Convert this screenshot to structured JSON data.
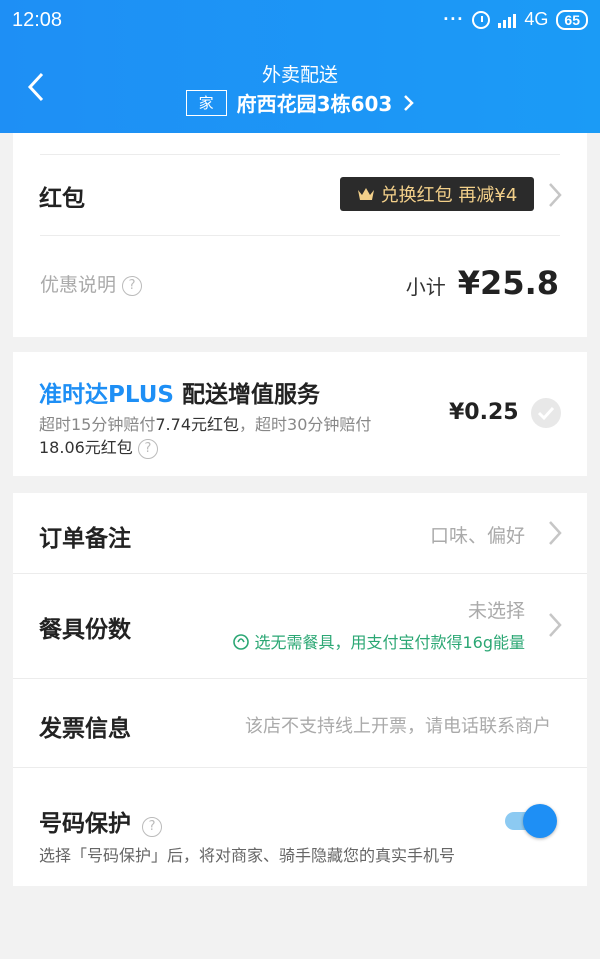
{
  "status_bar": {
    "time": "12:08",
    "network": "4G",
    "battery": "65"
  },
  "header": {
    "title": "外卖配送",
    "address_tag": "家",
    "address": "府西花园3栋603"
  },
  "coupon_card": {
    "label": "红包",
    "badge_text": "兑换红包 再减¥4",
    "discount_label": "优惠说明",
    "subtotal_label": "小计",
    "subtotal_value": "¥25.8"
  },
  "plus_card": {
    "brand": "准时达PLUS",
    "title": "配送增值服务",
    "desc_1": "超时15分钟赔付",
    "desc_1_value": "7.74元红包",
    "desc_2": "，超时30分钟赔付",
    "desc_2_value": "18.06元红包",
    "price": "¥0.25"
  },
  "options": {
    "remark": {
      "label": "订单备注",
      "value": "口味、偏好"
    },
    "tableware": {
      "label": "餐具份数",
      "value": "未选择",
      "hint": "选无需餐具，用支付宝付款得16g能量"
    },
    "invoice": {
      "label": "发票信息",
      "value": "该店不支持线上开票，请电话联系商户"
    },
    "privacy": {
      "label": "号码保护",
      "desc": "选择「号码保护」后，将对商家、骑手隐藏您的真实手机号",
      "enabled": true
    }
  },
  "colors": {
    "brand_blue": "#1e8ff5",
    "green": "#2ba774",
    "coupon_gold": "#f3d08a"
  }
}
